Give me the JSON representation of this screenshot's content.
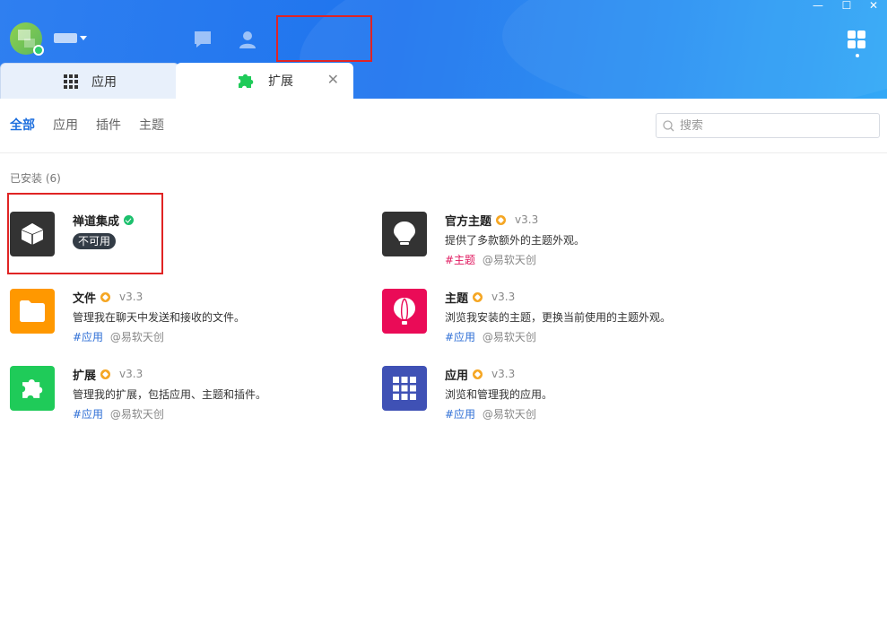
{
  "window": {
    "controls": {
      "minimize": "—",
      "maximize": "☐",
      "close": "✕"
    }
  },
  "header": {
    "icons": [
      "chat-icon",
      "user-icon",
      "apps-grid-icon"
    ],
    "colors": {
      "start": "#2f7ff0",
      "end": "#27a4f6",
      "status_online": "#2ecc71"
    }
  },
  "tabs": [
    {
      "label": "应用",
      "icon": "grid-icon"
    },
    {
      "label": "扩展",
      "icon": "puzzle-icon",
      "close": "✕"
    }
  ],
  "filters": {
    "all": "全部",
    "apps": "应用",
    "plugins": "插件",
    "themes": "主题"
  },
  "search": {
    "placeholder": "搜索"
  },
  "section": {
    "installed": "已安装 (6)"
  },
  "extensions": {
    "zentao": {
      "name": "禅道集成",
      "status": "不可用",
      "icon": "cube-icon",
      "icon_bg": "#333333"
    },
    "official_theme": {
      "name": "官方主题",
      "version": "v3.3",
      "desc": "提供了多款额外的主题外观。",
      "tag": "#主题",
      "author": "@易软天创",
      "icon": "lightbulb-icon",
      "icon_bg": "#333333"
    },
    "files": {
      "name": "文件",
      "version": "v3.3",
      "desc": "管理我在聊天中发送和接收的文件。",
      "tag": "#应用",
      "author": "@易软天创",
      "icon": "folder-icon",
      "icon_bg": "#ff9800"
    },
    "theme": {
      "name": "主题",
      "version": "v3.3",
      "desc": "浏览我安装的主题，更换当前使用的主题外观。",
      "tag": "#应用",
      "author": "@易软天创",
      "icon": "balloon-icon",
      "icon_bg": "#ea0b57"
    },
    "extensions": {
      "name": "扩展",
      "version": "v3.3",
      "desc": "管理我的扩展，包括应用、主题和插件。",
      "tag": "#应用",
      "author": "@易软天创",
      "icon": "puzzle-icon",
      "icon_bg": "#1fcb59"
    },
    "apps": {
      "name": "应用",
      "version": "v3.3",
      "desc": "浏览和管理我的应用。",
      "tag": "#应用",
      "author": "@易软天创",
      "icon": "grid-icon",
      "icon_bg": "#3f51b5"
    }
  }
}
